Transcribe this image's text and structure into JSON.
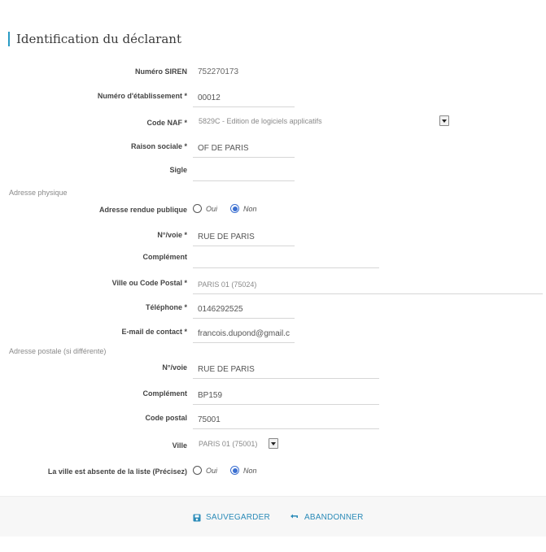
{
  "section_title": "Identification du déclarant",
  "fields": {
    "siren": {
      "label": "Numéro SIREN",
      "value": "752270173"
    },
    "etablissement": {
      "label": "Numéro d'établissement *",
      "value": "00012"
    },
    "naf": {
      "label": "Code NAF *",
      "value": "5829C - Edition de logiciels applicatifs"
    },
    "raison_sociale": {
      "label": "Raison sociale *",
      "value": "OF DE PARIS"
    },
    "sigle": {
      "label": "Sigle",
      "value": ""
    }
  },
  "adresse_physique": {
    "heading": "Adresse physique",
    "publique": {
      "label": "Adresse rendue publique",
      "oui": "Oui",
      "non": "Non",
      "selected": "Non"
    },
    "voie": {
      "label": "N°/voie *",
      "value": "RUE DE PARIS"
    },
    "complement": {
      "label": "Complément",
      "value": ""
    },
    "ville": {
      "label": "Ville ou Code Postal *",
      "value": "PARIS 01 (75024)"
    },
    "telephone": {
      "label": "Téléphone *",
      "value": "0146292525"
    },
    "email": {
      "label": "E-mail de contact *",
      "value": "francois.dupond@gmail.c"
    }
  },
  "adresse_postale": {
    "heading": "Adresse postale (si différente)",
    "voie": {
      "label": "N°/voie",
      "value": "RUE DE PARIS"
    },
    "complement": {
      "label": "Complément",
      "value": "BP159"
    },
    "code_postal": {
      "label": "Code postal",
      "value": "75001"
    },
    "ville": {
      "label": "Ville",
      "value": "PARIS 01 (75001)"
    },
    "absente": {
      "label": "La ville est absente de la liste (Précisez)",
      "oui": "Oui",
      "non": "Non",
      "selected": "Non"
    }
  },
  "footer": {
    "save_label": "SAUVEGARDER",
    "cancel_label": "ABANDONNER"
  },
  "colors": {
    "accent": "#2b8bb8",
    "radio": "#3b6fd0"
  },
  "icons": {
    "save": "floppy-disk-icon",
    "cancel": "undo-arrow-icon"
  }
}
